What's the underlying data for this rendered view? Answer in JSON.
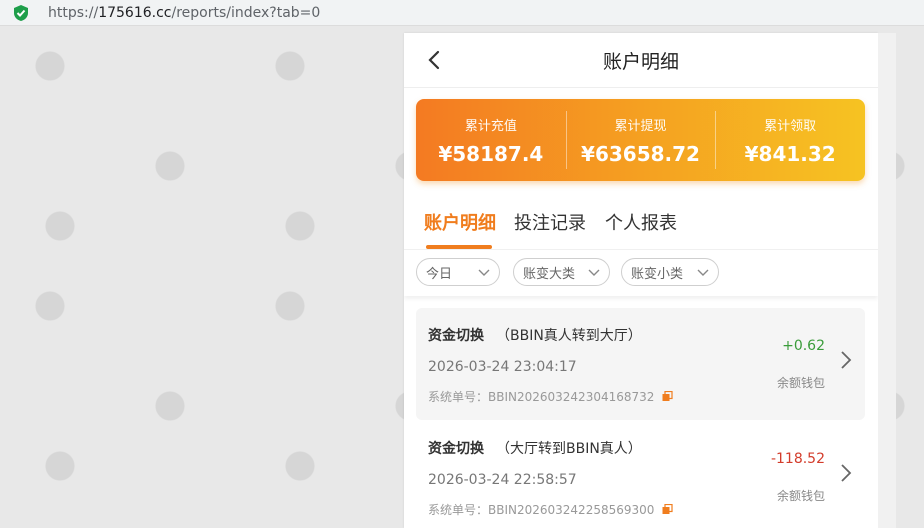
{
  "browser": {
    "url_prefix": "https://",
    "url_host": "175616.cc",
    "url_path": "/reports/index?tab=0"
  },
  "header": {
    "title": "账户明细"
  },
  "summary": [
    {
      "label": "累计充值",
      "value": "¥58187.4"
    },
    {
      "label": "累计提现",
      "value": "¥63658.72"
    },
    {
      "label": "累计领取",
      "value": "¥841.32"
    }
  ],
  "tabs": [
    {
      "label": "账户明细",
      "active": true
    },
    {
      "label": "投注记录",
      "active": false
    },
    {
      "label": "个人报表",
      "active": false
    }
  ],
  "filters": [
    {
      "label": "今日"
    },
    {
      "label": "账变大类"
    },
    {
      "label": "账变小类"
    }
  ],
  "records": [
    {
      "title": "资金切换",
      "detail": "（BBIN真人转到大厅）",
      "time": "2026-03-24 23:04:17",
      "order": "系统单号：BBIN202603242304168732",
      "amount": "+0.62",
      "wallet": "余额钱包"
    },
    {
      "title": "资金切换",
      "detail": "（大厅转到BBIN真人）",
      "time": "2026-03-24 22:58:57",
      "order": "系统单号：BBIN202603242258569300",
      "amount": "-118.52",
      "wallet": "余额钱包"
    }
  ],
  "colors": {
    "accent": "#f07d1e",
    "positive": "#3a9c3a",
    "negative": "#d33c2b"
  }
}
